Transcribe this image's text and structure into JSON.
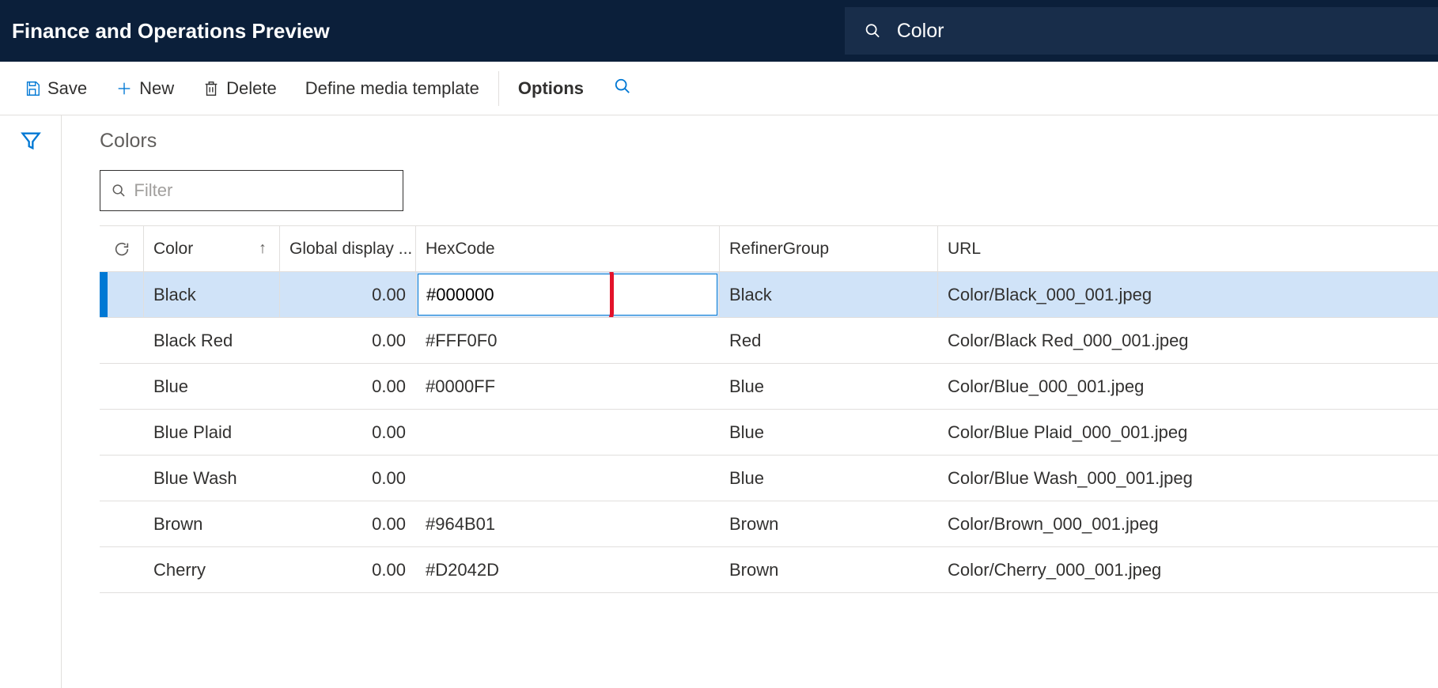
{
  "header": {
    "title": "Finance and Operations Preview",
    "search_value": "Color"
  },
  "toolbar": {
    "save": "Save",
    "new": "New",
    "delete": "Delete",
    "define_media": "Define media template",
    "options": "Options"
  },
  "page": {
    "title": "Colors",
    "filter_placeholder": "Filter"
  },
  "columns": {
    "color": "Color",
    "global_display": "Global display ...",
    "hexcode": "HexCode",
    "refiner": "RefinerGroup",
    "url": "URL"
  },
  "rows": [
    {
      "color": "Black",
      "gdisp": "0.00",
      "hex": "#000000",
      "refiner": "Black",
      "url": "Color/Black_000_001.jpeg",
      "selected": true,
      "editing": true
    },
    {
      "color": "Black Red",
      "gdisp": "0.00",
      "hex": "#FFF0F0",
      "refiner": "Red",
      "url": "Color/Black Red_000_001.jpeg",
      "selected": false,
      "editing": false
    },
    {
      "color": "Blue",
      "gdisp": "0.00",
      "hex": "#0000FF",
      "refiner": "Blue",
      "url": "Color/Blue_000_001.jpeg",
      "selected": false,
      "editing": false
    },
    {
      "color": "Blue Plaid",
      "gdisp": "0.00",
      "hex": "",
      "refiner": "Blue",
      "url": "Color/Blue Plaid_000_001.jpeg",
      "selected": false,
      "editing": false
    },
    {
      "color": "Blue Wash",
      "gdisp": "0.00",
      "hex": "",
      "refiner": "Blue",
      "url": "Color/Blue Wash_000_001.jpeg",
      "selected": false,
      "editing": false
    },
    {
      "color": "Brown",
      "gdisp": "0.00",
      "hex": "#964B01",
      "refiner": "Brown",
      "url": "Color/Brown_000_001.jpeg",
      "selected": false,
      "editing": false
    },
    {
      "color": "Cherry",
      "gdisp": "0.00",
      "hex": "#D2042D",
      "refiner": "Brown",
      "url": "Color/Cherry_000_001.jpeg",
      "selected": false,
      "editing": false
    }
  ]
}
